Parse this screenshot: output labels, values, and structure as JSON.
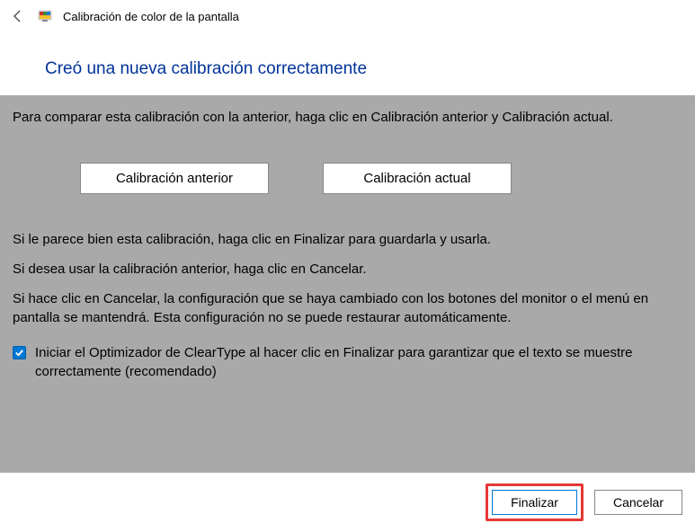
{
  "titlebar": {
    "title": "Calibración de color de la pantalla"
  },
  "heading": "Creó una nueva calibración correctamente",
  "body": {
    "compare_intro": "Para comparar esta calibración con la anterior, haga clic en Calibración anterior y Calibración actual.",
    "prev_btn": "Calibración anterior",
    "curr_btn": "Calibración actual",
    "finish_hint": "Si le parece bien esta calibración, haga clic en Finalizar para guardarla y usarla.",
    "cancel_hint": "Si desea usar la calibración anterior, haga clic en Cancelar.",
    "warn": "Si hace clic en Cancelar, la configuración que se haya cambiado con los botones del monitor o el menú en pantalla se mantendrá. Esta configuración no se puede restaurar automáticamente.",
    "cleartype_label": "Iniciar el Optimizador de ClearType al hacer clic en Finalizar para garantizar que el texto se muestre correctamente (recomendado)"
  },
  "footer": {
    "finish": "Finalizar",
    "cancel": "Cancelar"
  }
}
